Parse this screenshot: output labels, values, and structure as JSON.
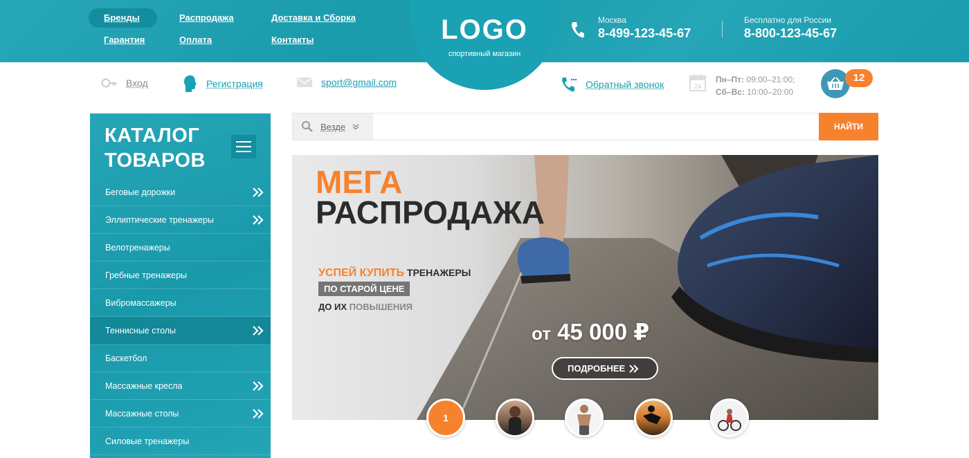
{
  "nav": {
    "items": [
      {
        "label": "Бренды",
        "active": true
      },
      {
        "label": "Распродажа",
        "active": false
      },
      {
        "label": "Доставка и Сборка",
        "active": false
      },
      {
        "label": "Гарантия",
        "active": false
      },
      {
        "label": "Оплата",
        "active": false
      },
      {
        "label": "Контакты",
        "active": false
      }
    ]
  },
  "logo": {
    "brand": "LOGO",
    "tagline": "спортивный магазин"
  },
  "phones": [
    {
      "label": "Москва",
      "number": "8-499-123-45-67"
    },
    {
      "label": "Бесплатно для России",
      "number": "8-800-123-45-67"
    }
  ],
  "subbar": {
    "login": "Вход",
    "register": "Регистрация",
    "email": "sport@gmail.com",
    "callback": "Обратный звонок",
    "hours_weekdays_label": "Пн–Пт:",
    "hours_weekdays": "09:00–21:00;",
    "hours_weekend_label": "Сб–Вс:",
    "hours_weekend": "10:00–20:00",
    "calendar_day": "24",
    "cart_count": "12"
  },
  "catalog": {
    "title_line1": "КАТАЛОГ",
    "title_line2": "ТОВАРОВ",
    "items": [
      {
        "label": "Беговые дорожки",
        "has_sub": true,
        "active": false
      },
      {
        "label": "Эллиптические тренажеры",
        "has_sub": true,
        "active": false
      },
      {
        "label": "Велотренажеры",
        "has_sub": false,
        "active": false
      },
      {
        "label": "Гребные тренажеры",
        "has_sub": false,
        "active": false
      },
      {
        "label": "Вибромассажеры",
        "has_sub": false,
        "active": false
      },
      {
        "label": "Теннисные столы",
        "has_sub": true,
        "active": true
      },
      {
        "label": "Баскетбол",
        "has_sub": false,
        "active": false
      },
      {
        "label": "Массажные кресла",
        "has_sub": true,
        "active": false
      },
      {
        "label": "Массажные столы",
        "has_sub": true,
        "active": false
      },
      {
        "label": "Силовые тренажеры",
        "has_sub": false,
        "active": false
      }
    ]
  },
  "search": {
    "scope": "Везде",
    "placeholder": "",
    "button": "НАЙТИ"
  },
  "banner": {
    "title_accent": "МЕГА",
    "title_main": "РАСПРОДАЖА",
    "line1_accent": "УСПЕЙ КУПИТЬ",
    "line1_rest": "ТРЕНАЖЕРЫ",
    "line2": "ПО СТАРОЙ ЦЕНЕ",
    "line3_a": "ДО ИХ",
    "line3_b": "ПОВЫШЕНИЯ",
    "price_prefix": "от",
    "price": "45 000 ₽",
    "more_button": "ПОДРОБНЕЕ"
  },
  "slider": {
    "current": "1"
  },
  "colors": {
    "primary": "#1aa1b3",
    "primary_dark": "#128898",
    "accent": "#f7822e"
  }
}
